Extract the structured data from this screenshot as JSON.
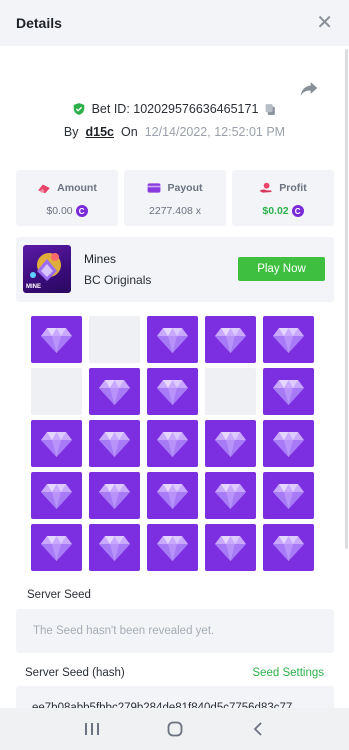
{
  "header": {
    "title": "Details",
    "close_icon": "close-icon"
  },
  "bet": {
    "bet_id_label": "Bet ID: 102029576636465171",
    "by_label": "By",
    "user": "d15c",
    "on_label": "On",
    "date": "12/14/2022, 12:52:01 PM"
  },
  "stats": {
    "amount": {
      "label": "Amount",
      "value": "$0.00"
    },
    "payout": {
      "label": "Payout",
      "value": "2277.408 x"
    },
    "profit": {
      "label": "Profit",
      "value": "$0.02"
    }
  },
  "game": {
    "name": "Mines",
    "provider": "BC Originals",
    "thumb_label": "MINE",
    "play_label": "Play Now"
  },
  "grid": [
    "gem",
    "empty",
    "gem",
    "gem",
    "gem",
    "empty",
    "gem",
    "gem",
    "empty",
    "gem",
    "gem",
    "gem",
    "gem",
    "gem",
    "gem",
    "gem",
    "gem",
    "gem",
    "gem",
    "gem",
    "gem",
    "gem",
    "gem",
    "gem",
    "gem"
  ],
  "server_seed": {
    "label": "Server Seed",
    "placeholder": "The Seed hasn't been revealed yet."
  },
  "server_seed_hash": {
    "label": "Server Seed (hash)",
    "settings_label": "Seed Settings",
    "value": "ee7b08abb5fbbc279b284de81f840d5c7756d83c77"
  },
  "colors": {
    "gem_tile": "#7b2fe0",
    "accent_green": "#3fbf3f",
    "panel_bg": "#f2f4f7"
  }
}
